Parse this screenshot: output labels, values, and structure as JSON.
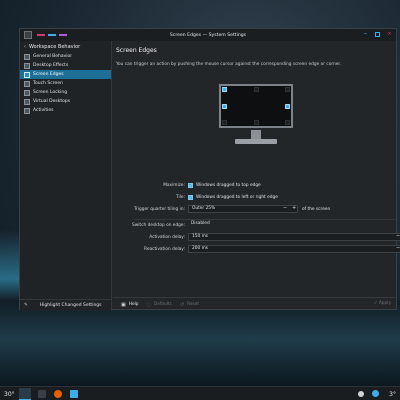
{
  "window": {
    "title": "Screen Edges — System Settings",
    "title_dash_colors": [
      "#e0356f",
      "#3daee9",
      "#b45ad8"
    ]
  },
  "sidebar": {
    "header": "Workspace Behavior",
    "items": [
      {
        "label": "General Behavior",
        "icon": "general-behavior-icon"
      },
      {
        "label": "Desktop Effects",
        "icon": "desktop-effects-icon"
      },
      {
        "label": "Screen Edges",
        "icon": "screen-edges-icon",
        "selected": true
      },
      {
        "label": "Touch Screen",
        "icon": "touch-screen-icon"
      },
      {
        "label": "Screen Locking",
        "icon": "screen-locking-icon"
      },
      {
        "label": "Virtual Desktops",
        "icon": "virtual-desktops-icon"
      },
      {
        "label": "Activities",
        "icon": "activities-icon"
      }
    ],
    "footer_label": "Highlight Changed Settings"
  },
  "page": {
    "title": "Screen Edges",
    "description": "You can trigger an action by pushing the mouse cursor against the corresponding screen edge or corner.",
    "maximize_label": "Maximize:",
    "maximize_value": "Windows dragged to top edge",
    "tile_label": "Tile:",
    "tile_value": "Windows dragged to left or right edge",
    "quarter_label": "Trigger quarter tiling in:",
    "quarter_value": "Outer 25%",
    "quarter_suffix": "of the screen",
    "switch_label": "Switch desktop on edge:",
    "switch_value": "Disabled",
    "activation_label": "Activation delay:",
    "activation_value": "150 ms",
    "reactivation_label": "Reactivation delay:",
    "reactivation_value": "200 ms"
  },
  "buttons": {
    "help": "Help",
    "defaults": "Defaults",
    "reset": "Reset",
    "apply": "Apply"
  },
  "taskbar": {
    "temp_left": "30°",
    "temp_right": "3°"
  },
  "colors": {
    "accent": "#3daee9",
    "selection": "#1d6f97",
    "window_bg": "#232629"
  }
}
